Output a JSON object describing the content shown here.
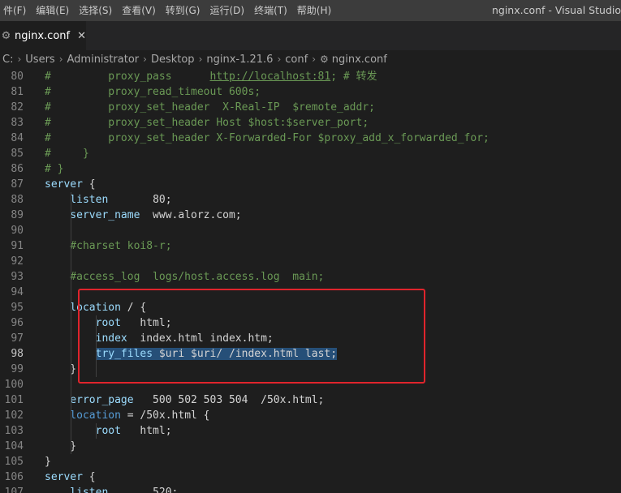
{
  "menu": {
    "items": [
      "件(F)",
      "编辑(E)",
      "选择(S)",
      "查看(V)",
      "转到(G)",
      "运行(D)",
      "终端(T)",
      "帮助(H)"
    ],
    "window_title": "nginx.conf - Visual Studio"
  },
  "tab": {
    "label": "nginx.conf",
    "close": "✕"
  },
  "breadcrumb": {
    "parts": [
      "C:",
      "Users",
      "Administrator",
      "Desktop",
      "nginx-1.21.6",
      "conf",
      "nginx.conf"
    ]
  },
  "editor": {
    "active_line": 98,
    "lines": [
      {
        "n": "80",
        "segs": [
          [
            "c-comment",
            "#         proxy_pass      "
          ],
          [
            "c-link",
            "http://localhost:81"
          ],
          [
            "c-comment",
            "; # 转发"
          ]
        ]
      },
      {
        "n": "81",
        "segs": [
          [
            "c-comment",
            "#         proxy_read_timeout 600s;"
          ]
        ]
      },
      {
        "n": "82",
        "segs": [
          [
            "c-comment",
            "#         proxy_set_header  X-Real-IP  $remote_addr;"
          ]
        ]
      },
      {
        "n": "83",
        "segs": [
          [
            "c-comment",
            "#         proxy_set_header Host $host:$server_port;"
          ]
        ]
      },
      {
        "n": "84",
        "segs": [
          [
            "c-comment",
            "#         proxy_set_header X-Forwarded-For $proxy_add_x_forwarded_for;"
          ]
        ]
      },
      {
        "n": "85",
        "segs": [
          [
            "c-comment",
            "#     }"
          ]
        ]
      },
      {
        "n": "86",
        "segs": [
          [
            "c-comment",
            "# }"
          ]
        ]
      },
      {
        "n": "87",
        "segs": [
          [
            "c-key",
            "server"
          ],
          [
            "c-brace",
            " {"
          ]
        ]
      },
      {
        "n": "88",
        "segs": [
          [
            "c-key",
            "    listen"
          ],
          [
            "c-val",
            "       80;"
          ]
        ]
      },
      {
        "n": "89",
        "segs": [
          [
            "c-key",
            "    server_name"
          ],
          [
            "c-val",
            "  www.alorz.com;"
          ]
        ]
      },
      {
        "n": "90",
        "segs": []
      },
      {
        "n": "91",
        "segs": [
          [
            "c-comment",
            "    #charset koi8-r;"
          ]
        ]
      },
      {
        "n": "92",
        "segs": []
      },
      {
        "n": "93",
        "segs": [
          [
            "c-comment",
            "    #access_log  logs/host.access.log  main;"
          ]
        ]
      },
      {
        "n": "94",
        "segs": []
      },
      {
        "n": "95",
        "segs": [
          [
            "c-key",
            "    location"
          ],
          [
            "c-val",
            " / {"
          ]
        ]
      },
      {
        "n": "96",
        "segs": [
          [
            "c-key",
            "        root"
          ],
          [
            "c-val",
            "   html;"
          ]
        ]
      },
      {
        "n": "97",
        "segs": [
          [
            "c-key",
            "        index"
          ],
          [
            "c-val",
            "  index.html index.htm;"
          ]
        ]
      },
      {
        "n": "98",
        "segs": [
          [
            "c-val",
            "        "
          ],
          [
            "sel c-key",
            "try_files"
          ],
          [
            "sel c-val",
            " $uri $uri/ /index.html last;"
          ]
        ]
      },
      {
        "n": "99",
        "segs": [
          [
            "c-val",
            "    }"
          ]
        ]
      },
      {
        "n": "100",
        "segs": []
      },
      {
        "n": "101",
        "segs": [
          [
            "c-key",
            "    error_page"
          ],
          [
            "c-val",
            "   500 502 503 504  /50x.html;"
          ]
        ]
      },
      {
        "n": "102",
        "segs": [
          [
            "c-kw",
            "    location"
          ],
          [
            "c-val",
            " = /50x.html {"
          ]
        ]
      },
      {
        "n": "103",
        "segs": [
          [
            "c-key",
            "        root"
          ],
          [
            "c-val",
            "   html;"
          ]
        ]
      },
      {
        "n": "104",
        "segs": [
          [
            "c-val",
            "    }"
          ]
        ]
      },
      {
        "n": "105",
        "segs": [
          [
            "c-val",
            "}"
          ]
        ]
      },
      {
        "n": "106",
        "segs": [
          [
            "c-key",
            "server"
          ],
          [
            "c-brace",
            " {"
          ]
        ]
      },
      {
        "n": "107",
        "segs": [
          [
            "c-key",
            "    listen"
          ],
          [
            "c-val",
            "       520;"
          ]
        ]
      }
    ]
  }
}
